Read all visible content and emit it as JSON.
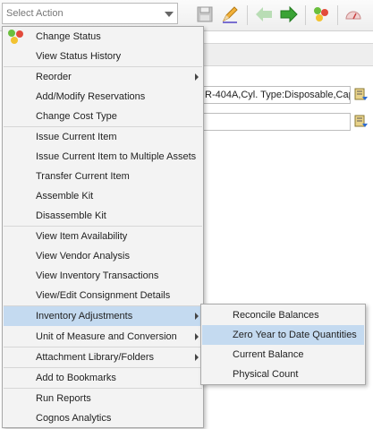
{
  "toolbar": {
    "select_action_placeholder": "Select Action",
    "icons": [
      "save-icon",
      "edit-pencil-icon",
      "previous-arrow-icon",
      "next-arrow-icon",
      "change-status-icon",
      "gauge-icon"
    ]
  },
  "fields": {
    "description_value": "R-404A,Cyl. Type:Disposable,Cap",
    "second_value": ""
  },
  "menu": {
    "items": [
      {
        "label": "Change Status",
        "submenu": false
      },
      {
        "label": "View Status History",
        "submenu": false
      },
      {
        "label": "Reorder",
        "submenu": true
      },
      {
        "label": "Add/Modify Reservations",
        "submenu": false
      },
      {
        "label": "Change Cost Type",
        "submenu": false
      },
      {
        "label": "Issue Current Item",
        "submenu": false
      },
      {
        "label": "Issue Current Item to Multiple Assets",
        "submenu": false
      },
      {
        "label": "Transfer Current Item",
        "submenu": false
      },
      {
        "label": "Assemble Kit",
        "submenu": false
      },
      {
        "label": "Disassemble Kit",
        "submenu": false
      },
      {
        "label": "View Item Availability",
        "submenu": false
      },
      {
        "label": "View Vendor Analysis",
        "submenu": false
      },
      {
        "label": "View Inventory Transactions",
        "submenu": false
      },
      {
        "label": "View/Edit Consignment Details",
        "submenu": false
      },
      {
        "label": "Inventory Adjustments",
        "submenu": true,
        "active": true
      },
      {
        "label": "Unit of Measure and Conversion",
        "submenu": true
      },
      {
        "label": "Attachment Library/Folders",
        "submenu": true
      },
      {
        "label": "Add to Bookmarks",
        "submenu": false
      },
      {
        "label": "Run Reports",
        "submenu": false
      },
      {
        "label": "Cognos Analytics",
        "submenu": false
      }
    ]
  },
  "submenu": {
    "items": [
      {
        "label": "Reconcile Balances"
      },
      {
        "label": "Zero Year to Date Quantities",
        "hover": true
      },
      {
        "label": "Current Balance"
      },
      {
        "label": "Physical Count"
      }
    ]
  },
  "colors": {
    "menu_bg": "#f3f3f3",
    "highlight": "#c4daf0",
    "green_arrow": "#3aa335"
  }
}
